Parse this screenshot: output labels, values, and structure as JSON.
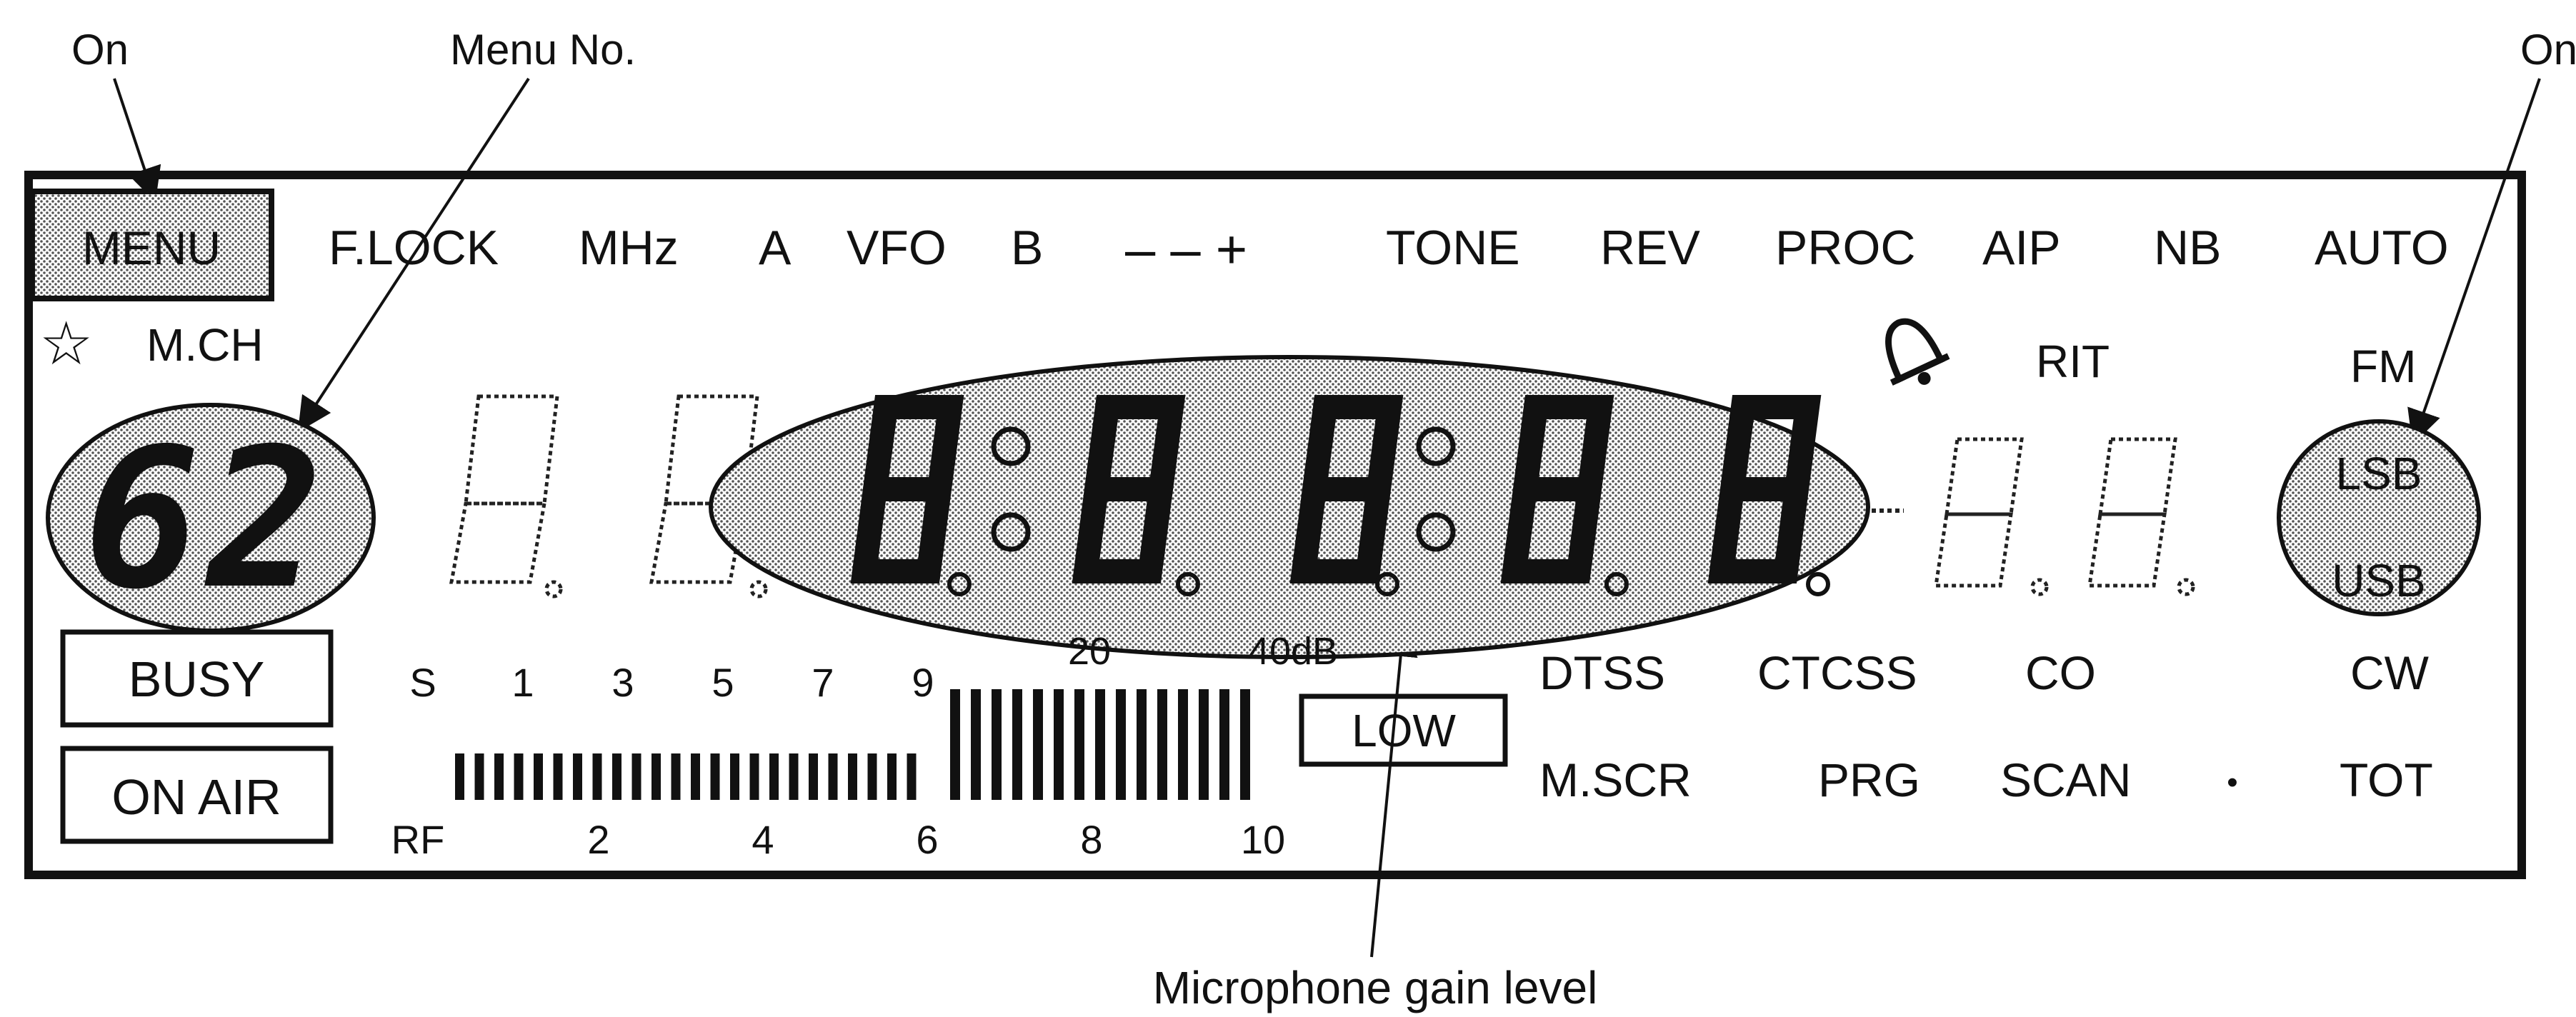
{
  "callouts": {
    "on_left": "On",
    "menu_no": "Menu No.",
    "on_right": "On",
    "mic_gain": "Microphone gain level"
  },
  "top_row": {
    "menu": "MENU",
    "flock": "F.LOCK",
    "mhz": "MHz",
    "a": "A",
    "vfo": "VFO",
    "b": "B",
    "minus_minus_plus": "– – +",
    "tone": "TONE",
    "rev": "REV",
    "proc": "PROC",
    "aip": "AIP",
    "nb": "NB",
    "auto": "AUTO"
  },
  "second_row": {
    "star_icon": "star-icon",
    "mch": "M.CH",
    "bell_icon": "bell-icon",
    "rit": "RIT",
    "fm": "FM"
  },
  "menu_number": "62",
  "modes": {
    "lsb": "LSB",
    "usb": "USB"
  },
  "left_boxes": {
    "busy": "BUSY",
    "on_air": "ON AIR"
  },
  "meter": {
    "s_labels": [
      "S",
      "1",
      "3",
      "5",
      "7",
      "9"
    ],
    "db_labels": [
      "20",
      "40dB"
    ],
    "rf_labels": [
      "RF",
      "2",
      "4",
      "6",
      "8",
      "10"
    ],
    "low": "LOW"
  },
  "right_labels": {
    "dtss": "DTSS",
    "ctcss": "CTCSS",
    "co": "CO",
    "cw": "CW",
    "mscr": "M.SCR",
    "prg": "PRG",
    "scan": "SCAN",
    "dot": "•",
    "tot": "TOT"
  },
  "colors": {
    "ink": "#111111",
    "shade": "#c8c8c8",
    "paper": "#ffffff"
  }
}
